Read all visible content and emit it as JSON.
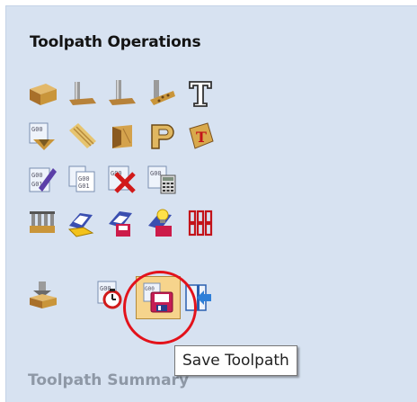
{
  "panel": {
    "title": "Toolpath Operations",
    "summary_title": "Toolpath Summary"
  },
  "tooltip": {
    "text": "Save Toolpath"
  },
  "colors": {
    "panel_bg": "#d7e2f1",
    "wood": "#c9953a",
    "highlight": "#e3121b",
    "tooltip_border": "#767676",
    "selected_bg": "#f6d48c"
  },
  "rows": [
    [
      "profile-icon",
      "pocket-icon",
      "drilling-icon",
      "inlay-icon",
      "text-icon"
    ],
    [
      "vcarve-icon",
      "fluting-icon",
      "prism-icon",
      "chamfer-icon",
      "engrave-icon"
    ],
    [
      "edit-toolpath-icon",
      "toolpath-template-icon",
      "delete-toolpath-icon",
      "calculate-icon"
    ],
    [
      "layers-icon",
      "folder-open-icon",
      "folder-save-icon",
      "folder-light-icon",
      "texture-icon"
    ],
    [
      "project-icon",
      "timer-icon",
      "save-toolpath-icon",
      "import-icon"
    ]
  ]
}
